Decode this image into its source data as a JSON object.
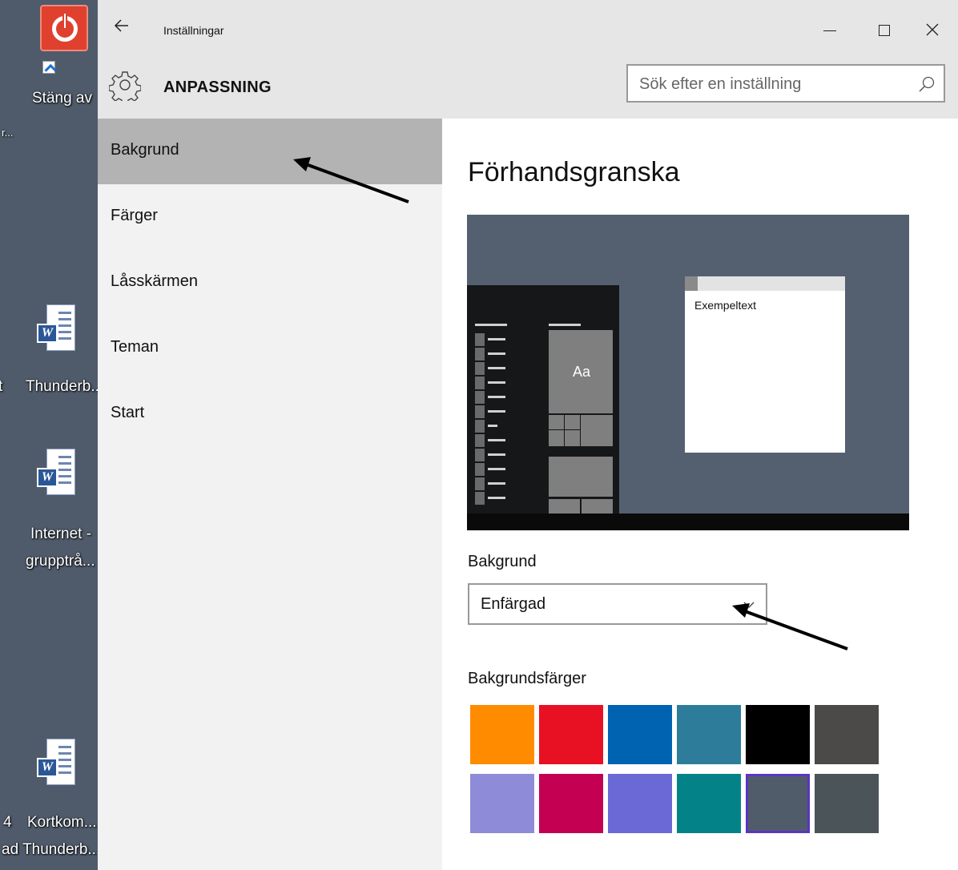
{
  "desktop": {
    "icons": [
      {
        "label": "Stäng av",
        "icon": "power-icon"
      },
      {
        "label": "Thunderb...",
        "icon": "word-icon"
      },
      {
        "label": "Internet -",
        "icon": "word-icon"
      },
      {
        "label": "grupptrå...",
        "icon": "word-icon"
      },
      {
        "label": "Kortkom...",
        "icon": "word-icon"
      },
      {
        "label": "ad Thunderb...",
        "icon": "word-icon"
      }
    ],
    "fragments": [
      "r...",
      "t",
      "4"
    ]
  },
  "window": {
    "title": "Inställningar",
    "back_icon": "arrow-left-icon",
    "section_title": "ANPASSNING",
    "section_icon": "gear-icon",
    "search_placeholder": "Sök efter en inställning",
    "search_icon": "search-icon"
  },
  "sidebar": {
    "items": [
      {
        "label": "Bakgrund",
        "active": true
      },
      {
        "label": "Färger",
        "active": false
      },
      {
        "label": "Låsskärmen",
        "active": false
      },
      {
        "label": "Teman",
        "active": false
      },
      {
        "label": "Start",
        "active": false
      }
    ]
  },
  "content": {
    "heading": "Förhandsgranska",
    "preview": {
      "window_text": "Exempeltext",
      "tile_label": "Aa",
      "background_color": "#546070"
    },
    "background_label": "Bakgrund",
    "background_value": "Enfärgad",
    "colors_label": "Bakgrundsfärger",
    "swatches": [
      "#ff8c00",
      "#e81123",
      "#0063b1",
      "#2d7d9a",
      "#000000",
      "#4c4a48",
      "#8e8cd8",
      "#c30052",
      "#6b69d6",
      "#038387",
      "#515c6b",
      "#4a5459"
    ],
    "selected_swatch": 10
  }
}
